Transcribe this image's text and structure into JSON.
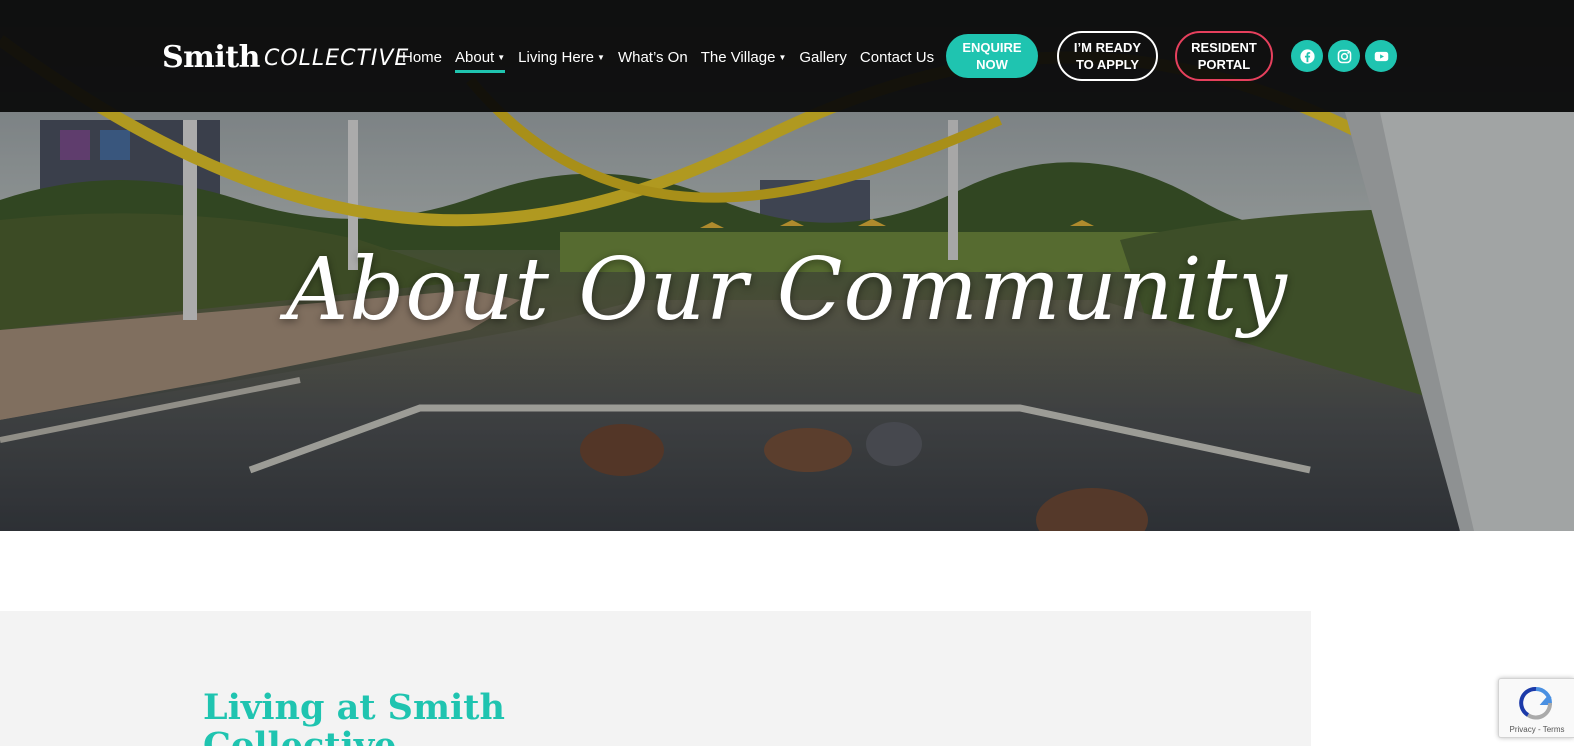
{
  "header": {
    "logo": {
      "main": "Smith",
      "sub": "COLLECTIVE"
    },
    "nav": [
      {
        "label": "Home",
        "has_dropdown": false,
        "active": false
      },
      {
        "label": "About",
        "has_dropdown": true,
        "active": true
      },
      {
        "label": "Living Here",
        "has_dropdown": true,
        "active": false
      },
      {
        "label": "What’s On",
        "has_dropdown": false,
        "active": false
      },
      {
        "label": "The Village",
        "has_dropdown": true,
        "active": false
      },
      {
        "label": "Gallery",
        "has_dropdown": false,
        "active": false
      },
      {
        "label": "Contact Us",
        "has_dropdown": false,
        "active": false
      }
    ],
    "buttons": {
      "enquire": "ENQUIRE\nNOW",
      "apply": "I’M READY\nTO APPLY",
      "portal": "RESIDENT\nPORTAL"
    },
    "social_icons": [
      "facebook-icon",
      "instagram-icon",
      "youtube-icon"
    ]
  },
  "hero": {
    "title": "About Our Community"
  },
  "content": {
    "heading": "Living at Smith Collective"
  },
  "recaptcha": {
    "links": "Privacy - Terms"
  },
  "colors": {
    "accent": "#1fc4b0",
    "portal_border": "#e6405d",
    "header_bg": "#0a0a0a",
    "panel_bg": "#f3f3f3"
  }
}
